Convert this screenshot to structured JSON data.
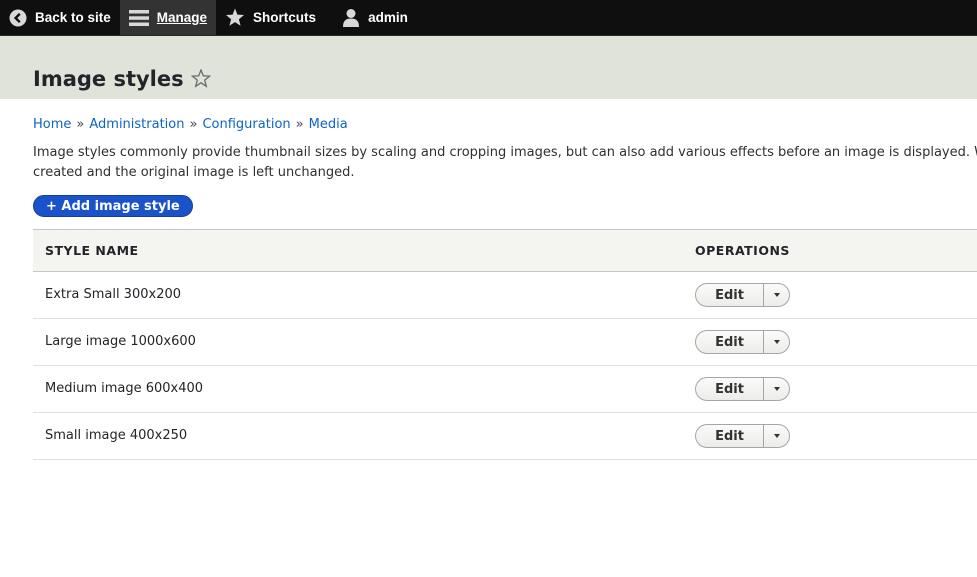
{
  "toolbar": {
    "items": [
      {
        "label": "Back to site",
        "icon": "back-arrow-icon"
      },
      {
        "label": "Manage",
        "icon": "hamburger-menu-icon",
        "active": true
      },
      {
        "label": "Shortcuts",
        "icon": "star-icon"
      },
      {
        "label": "admin",
        "icon": "user-icon"
      }
    ]
  },
  "page": {
    "title": "Image styles",
    "favorite_icon": "star-outline-icon"
  },
  "breadcrumb": {
    "items": [
      "Home",
      "Administration",
      "Configuration",
      "Media"
    ],
    "separator": "»"
  },
  "description": {
    "line1": "Image styles commonly provide thumbnail sizes by scaling and cropping images, but can also add various effects before an image is displayed. W",
    "line2": "created and the original image is left unchanged."
  },
  "actions": {
    "add_label": "+ Add image style"
  },
  "table": {
    "headers": {
      "name": "STYLE NAME",
      "operations": "OPERATIONS"
    },
    "rows": [
      {
        "name": "Extra Small 300x200",
        "edit": "Edit"
      },
      {
        "name": "Large image 1000x600",
        "edit": "Edit"
      },
      {
        "name": "Medium image 600x400",
        "edit": "Edit"
      },
      {
        "name": "Small image 400x250",
        "edit": "Edit"
      }
    ]
  },
  "colors": {
    "toolbar_bg": "#0f0f0f",
    "header_bg": "#e0e3da",
    "link": "#0f63c4",
    "primary_button": "#1a52c9"
  }
}
